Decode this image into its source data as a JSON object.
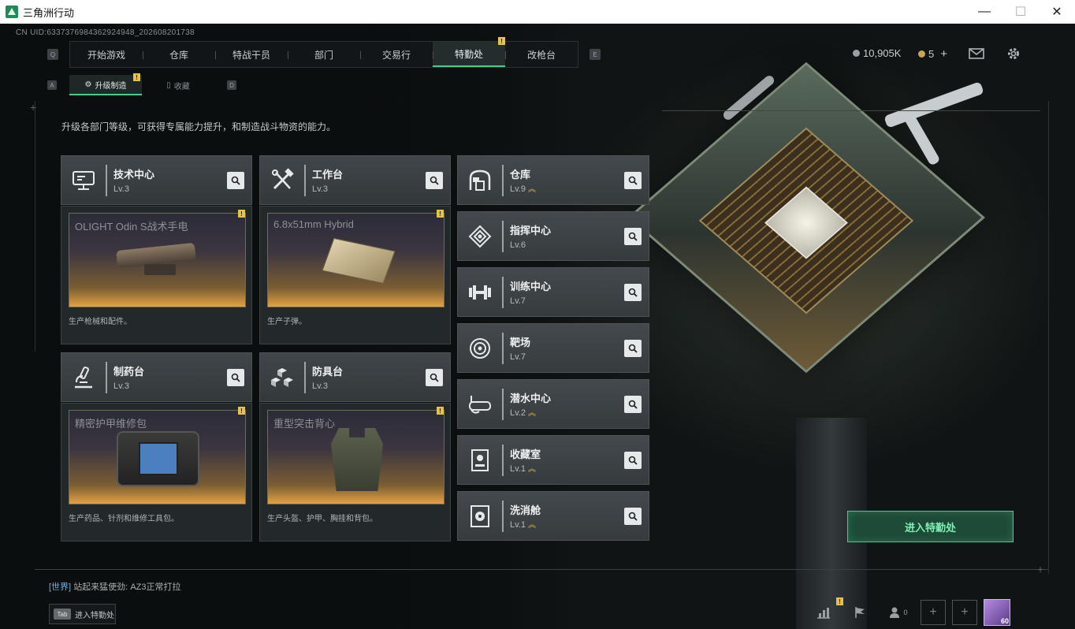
{
  "window": {
    "title": "三角洲行动",
    "minimize": "—",
    "maximize": "☐",
    "close": "✕"
  },
  "uid": "CN UID:6337376984362924948_202608201738",
  "nav": {
    "left_key": "Q",
    "right_key": "E",
    "tabs": [
      "开始游戏",
      "仓库",
      "特战干员",
      "部门",
      "交易行",
      "特勤处",
      "改枪台"
    ],
    "active_tab": "特勤处",
    "badge": "!"
  },
  "currency": {
    "silver": "10,905K",
    "gold": "5",
    "gold_add": "+"
  },
  "subnav": {
    "left_key": "A",
    "right_key": "D",
    "tabs": [
      "升级制造",
      "收藏"
    ],
    "active_tab": "升级制造",
    "badge": "!"
  },
  "description": "升级各部门等级，可获得专属能力提升，和制造战斗物资的能力。",
  "departments_main": [
    {
      "name": "技术中心",
      "level": "Lv.3",
      "icon": "computer-icon",
      "item": "OLIGHT Odin S战术手电",
      "caption": "生产枪械和配件。",
      "badge": "!"
    },
    {
      "name": "工作台",
      "level": "Lv.3",
      "icon": "tools-icon",
      "item": "6.8x51mm Hybrid",
      "caption": "生产子弹。",
      "badge": "!"
    },
    {
      "name": "制药台",
      "level": "Lv.3",
      "icon": "microscope-icon",
      "item": "精密护甲维修包",
      "caption": "生产药品、针剂和维修工具包。",
      "badge": "!"
    },
    {
      "name": "防具台",
      "level": "Lv.3",
      "icon": "armor-blocks-icon",
      "item": "重型突击背心",
      "caption": "生产头盔、护甲、胸挂和背包。",
      "badge": "!"
    }
  ],
  "departments_side": [
    {
      "name": "仓库",
      "level": "Lv.9",
      "upgradable": true,
      "icon": "warehouse-icon"
    },
    {
      "name": "指挥中心",
      "level": "Lv.6",
      "upgradable": false,
      "icon": "command-icon"
    },
    {
      "name": "训练中心",
      "level": "Lv.7",
      "upgradable": false,
      "icon": "dumbbell-icon"
    },
    {
      "name": "靶场",
      "level": "Lv.7",
      "upgradable": false,
      "icon": "target-icon"
    },
    {
      "name": "潜水中心",
      "level": "Lv.2",
      "upgradable": true,
      "icon": "diving-mask-icon"
    },
    {
      "name": "收藏室",
      "level": "Lv.1",
      "upgradable": true,
      "icon": "collection-icon"
    },
    {
      "name": "洗消舱",
      "level": "Lv.1",
      "upgradable": true,
      "icon": "radiation-icon"
    }
  ],
  "enter_button": "进入特勤处",
  "chat": {
    "channel": "[世界]",
    "sender": "站起来猛使劲:",
    "message": "AZ3正常打拉"
  },
  "tab_hint": {
    "key": "Tab",
    "label": "进入特勤处"
  },
  "bottom": {
    "friends_count": "0",
    "avatar_level": "60",
    "badge": "!"
  },
  "colors": {
    "accent_green": "#3fd18a",
    "badge_yellow": "#e6c24a",
    "upgrade_gold": "#e5b84a"
  }
}
